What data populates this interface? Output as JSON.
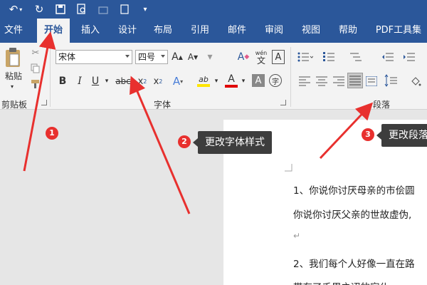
{
  "quick_access": {
    "undo_icon": "undo-icon",
    "redo_icon": "redo-icon",
    "save_icon": "save-icon",
    "print_preview_icon": "print-preview-icon",
    "more_icon": "customize-icon"
  },
  "tabs": [
    {
      "label": "文件"
    },
    {
      "label": "开始"
    },
    {
      "label": "插入"
    },
    {
      "label": "设计"
    },
    {
      "label": "布局"
    },
    {
      "label": "引用"
    },
    {
      "label": "邮件"
    },
    {
      "label": "审阅"
    },
    {
      "label": "视图"
    },
    {
      "label": "帮助"
    },
    {
      "label": "PDF工具集"
    }
  ],
  "ribbon": {
    "clipboard": {
      "paste_label": "粘贴",
      "group_label": "剪贴板"
    },
    "font": {
      "font_name": "宋体",
      "font_size": "四号",
      "grow_font": "A",
      "shrink_font": "A",
      "clear_format": "A",
      "phonetic_top": "wén",
      "phonetic_bottom": "文",
      "char_border": "A",
      "bold": "B",
      "italic": "I",
      "underline": "U",
      "strikethrough": "abc",
      "subscript": "x",
      "superscript": "x",
      "text_effect": "A",
      "highlight": "ab",
      "font_color": "A",
      "char_shading": "A",
      "enclose": "字",
      "group_label": "字体"
    },
    "paragraph": {
      "group_label": "段落"
    },
    "colors": {
      "highlight": "#ffe600",
      "font_color": "#e00000",
      "accent": "#2b579a"
    }
  },
  "document": {
    "line1": "1、你说你讨厌母亲的市侩圆",
    "line2": "你说你讨厌父亲的世故虚伪,",
    "para_mark": "↵",
    "line3": "2、我们每个人好像一直在路",
    "line4": "带有了千里之迢的宿仆"
  },
  "callouts": [
    {
      "number": "1"
    },
    {
      "number": "2",
      "text": "更改字体样式"
    },
    {
      "number": "3",
      "text": "更改段落"
    }
  ]
}
